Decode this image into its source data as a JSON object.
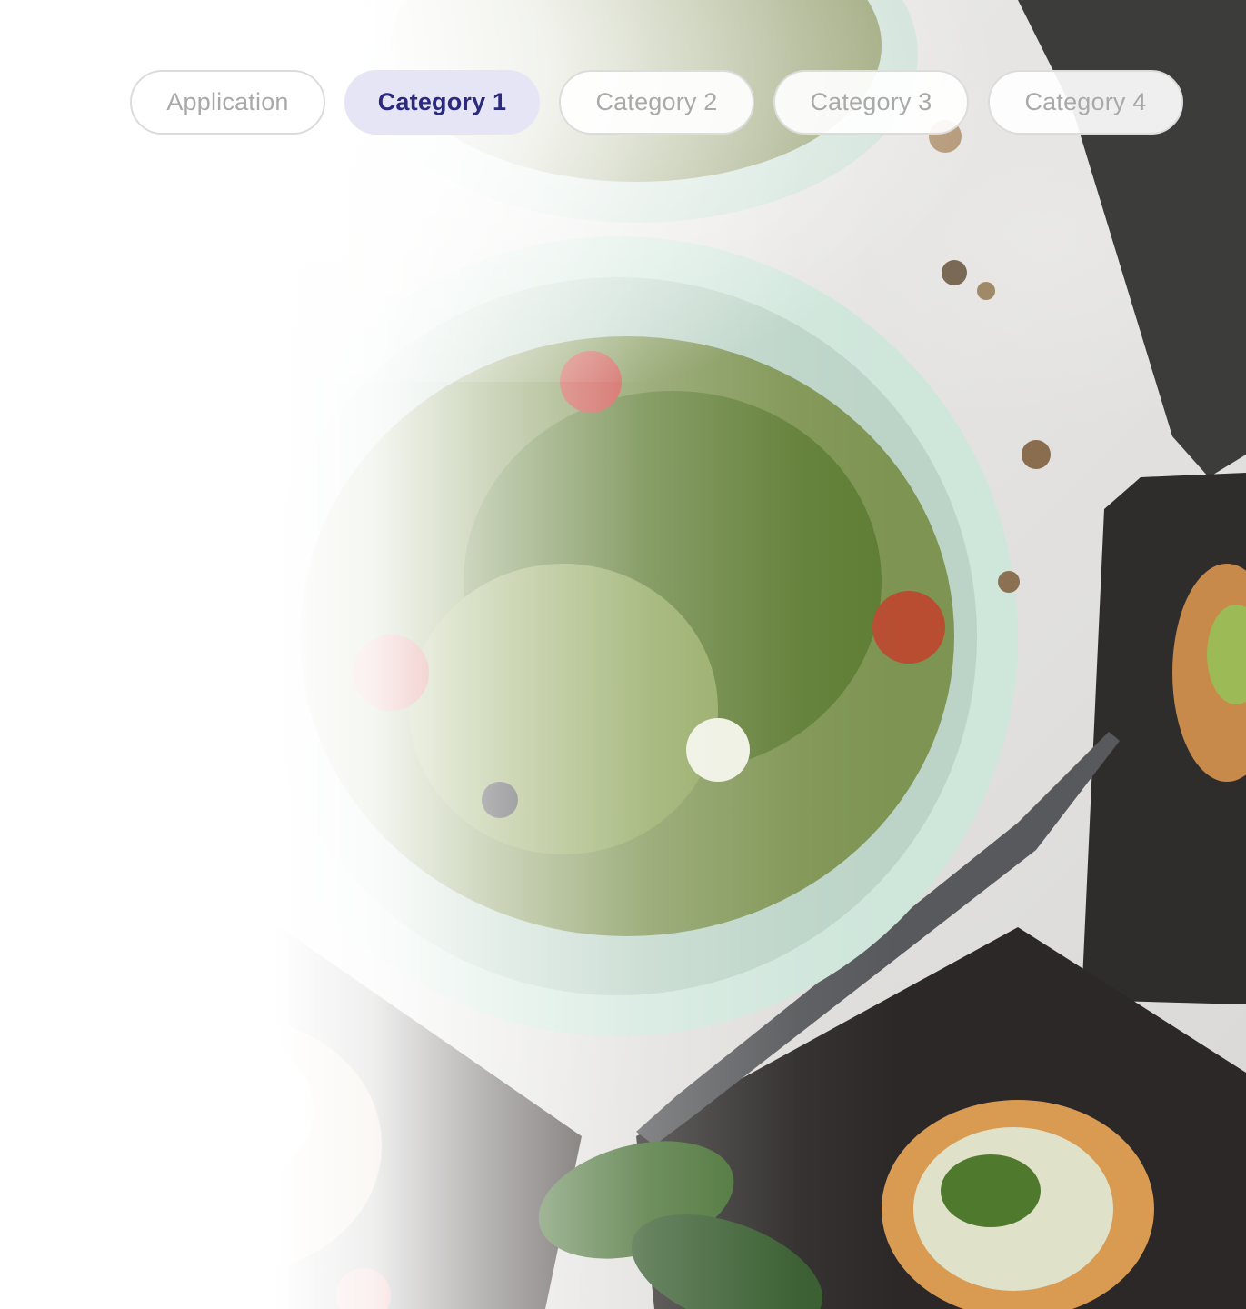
{
  "tabs": [
    {
      "label": "Application",
      "active": false
    },
    {
      "label": "Category 1",
      "active": true
    },
    {
      "label": "Category 2",
      "active": false
    },
    {
      "label": "Category 3",
      "active": false
    },
    {
      "label": "Category 4",
      "active": false
    }
  ],
  "colors": {
    "active_tab_background": "#e6e5f6",
    "active_tab_text": "#2b2a7c",
    "inactive_tab_text": "#a9a9a9",
    "inactive_tab_border": "#dcdcdc"
  },
  "background": {
    "image": "food-photo"
  }
}
